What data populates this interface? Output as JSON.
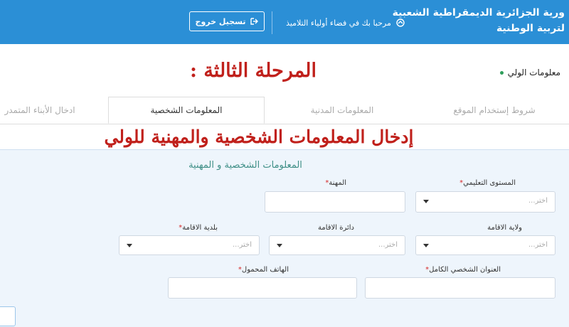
{
  "header": {
    "title_line1": "ورية الجزائرية الديمقراطية الشعبية",
    "title_line2": "لتربية الوطنية",
    "welcome_text": "مرحبا بك في فضاء أولياء التلاميذ",
    "logout_label": "تسجيل خروج",
    "logout_icon": "logout-arrow-icon"
  },
  "parent_info_label": "معلومات الولي",
  "overlay": {
    "stage": "المرحلة الثالثة :",
    "title": "إدخال المعلومات الشخصية والمهنية للولي"
  },
  "tabs": [
    {
      "label": "شروط إستخدام الموقع",
      "active": false
    },
    {
      "label": "المعلومات المدنية",
      "active": false
    },
    {
      "label": "المعلومات الشخصية",
      "active": true
    },
    {
      "label": "ادخال الأبناء المتمدر",
      "active": false
    }
  ],
  "form": {
    "section_title": "المعلومات الشخصية و المهنية",
    "education_level": {
      "label": "المستوى التعليمي",
      "placeholder": "اختر..."
    },
    "profession": {
      "label": "المهنة",
      "value": ""
    },
    "residence_wilaya": {
      "label": "ولاية الاقامة",
      "placeholder": "اختر..."
    },
    "residence_daira": {
      "label": "دائرة الاقامة",
      "placeholder": "اختر..."
    },
    "residence_commune": {
      "label": "بلدية الاقامة",
      "placeholder": "اختر..."
    },
    "full_address": {
      "label": "العنوان الشخصي الكامل",
      "value": ""
    },
    "mobile_phone": {
      "label": "الهاتف المحمول",
      "value": ""
    }
  },
  "colors": {
    "header_blue": "#2b8fd6",
    "required_red": "#d62a2a",
    "overlay_red": "#c0201b",
    "section_teal": "#3f8f87",
    "panel_bg": "#eef5fc"
  }
}
